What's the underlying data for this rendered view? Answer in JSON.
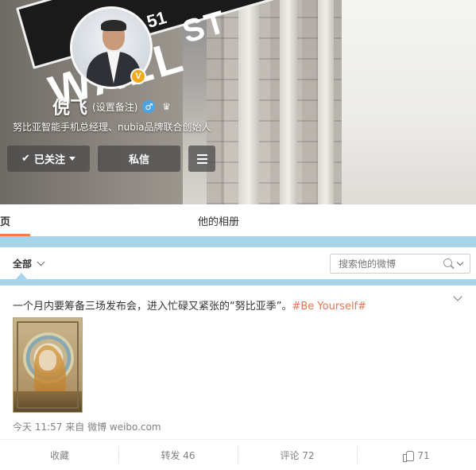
{
  "profile": {
    "name": "倪飞",
    "remark_link": "(设置备注)",
    "gender_icon": "male-icon",
    "member_icon": "vip-icon",
    "verified_badge": "V",
    "description": "努比亚智能手机总经理、nubia品牌联合创始人",
    "cover_sign_main": "WALL",
    "cover_sign_st": "ST",
    "cover_sign_num": "51"
  },
  "actions": {
    "follow_label": "已关注",
    "message_label": "私信",
    "menu_icon": "hamburger-menu-icon"
  },
  "tabs": [
    {
      "label": "主页",
      "active": true
    },
    {
      "label": "他的相册",
      "active": false
    }
  ],
  "filter": {
    "all_label": "全部",
    "search_placeholder": "搜索他的微博"
  },
  "post": {
    "text": "一个月内要筹备三场发布会，进入忙碌又紧张的“努比亚季”。",
    "hashtag": "#Be Yourself#",
    "time": "今天 11:57",
    "source_prefix": "来自",
    "source": "微博 weibo.com",
    "image_icon": "art-nouveau-zodiac-image"
  },
  "post_actions": {
    "favorite": "收藏",
    "forward": "转发 46",
    "comment": "评论 72",
    "like_count": "71"
  },
  "colors": {
    "accent": "#fa7d3c",
    "hashtag": "#eb7350",
    "divider_blue": "#a9d3e8",
    "verified": "#f3a91c"
  }
}
